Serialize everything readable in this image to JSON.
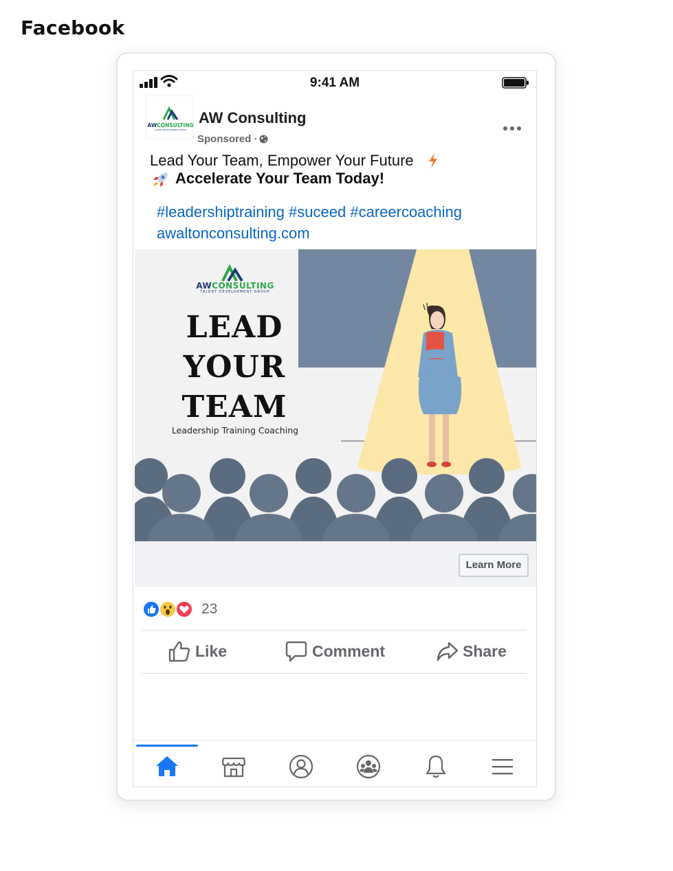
{
  "page_label": "Facebook",
  "status_bar": {
    "time": "9:41 AM",
    "icons": [
      "signal-icon",
      "wifi-icon",
      "battery-icon"
    ]
  },
  "post": {
    "page_name": "AW Consulting",
    "sponsored": "Sponsored · ",
    "text_line_1": "Lead Your Team, Empower Your Future",
    "text_line_2": "Accelerate Your Team Today!",
    "hashtags": [
      "#leadershiptraining",
      "#suceed",
      "#careercoaching"
    ],
    "link": "awaltonconsulting.com"
  },
  "ad_image": {
    "logo_text_a": "AW",
    "logo_text_b": "CONSULTING",
    "logo_tagline": "TALENT DEVELOPMENT GROUP",
    "title_lines": [
      "LEAD",
      "YOUR",
      "TEAM"
    ],
    "subtitle": "Leadership Training Coaching",
    "colors": {
      "spotlight": "#fde7a9",
      "backdrop": "#7487a0",
      "audience": "#5b6b80"
    }
  },
  "cta": {
    "label": "Learn More"
  },
  "reactions": {
    "icons": [
      "like-icon",
      "wow-icon",
      "love-icon"
    ],
    "count": "23"
  },
  "actions": {
    "like": "Like",
    "comment": "Comment",
    "share": "Share"
  },
  "bottom_nav": {
    "items": [
      "home-icon",
      "marketplace-icon",
      "profile-icon",
      "groups-icon",
      "notifications-icon",
      "menu-icon"
    ],
    "active": "home-icon",
    "accent": "#1877f2"
  }
}
